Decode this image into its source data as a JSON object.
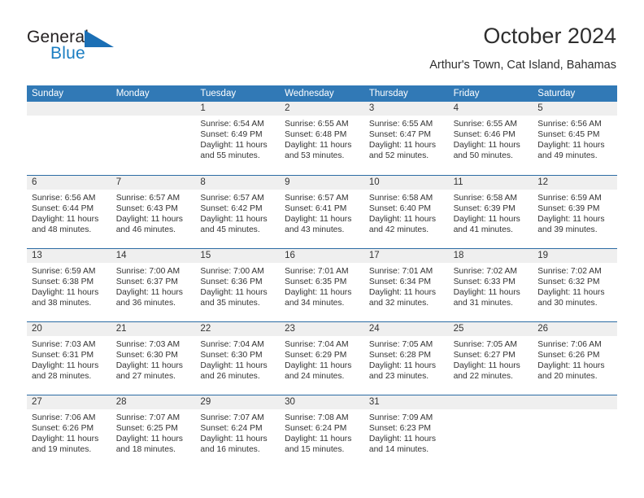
{
  "branding": {
    "logo_text_primary": "General",
    "logo_text_secondary": "Blue",
    "logo_flag_icon": "flag-triangle-icon",
    "accent_color": "#1b7ec2"
  },
  "header": {
    "title": "October 2024",
    "subtitle": "Arthur's Town, Cat Island, Bahamas"
  },
  "colors": {
    "header_row_bg": "#3179b6",
    "week_separator": "#2c6ca4",
    "daynum_band_bg": "#efefef",
    "text": "#333333"
  },
  "weekdays": [
    "Sunday",
    "Monday",
    "Tuesday",
    "Wednesday",
    "Thursday",
    "Friday",
    "Saturday"
  ],
  "weeks": [
    [
      {
        "day": "",
        "sunrise": "",
        "sunset": "",
        "daylight_line1": "",
        "daylight_line2": ""
      },
      {
        "day": "",
        "sunrise": "",
        "sunset": "",
        "daylight_line1": "",
        "daylight_line2": ""
      },
      {
        "day": "1",
        "sunrise": "Sunrise: 6:54 AM",
        "sunset": "Sunset: 6:49 PM",
        "daylight_line1": "Daylight: 11 hours",
        "daylight_line2": "and 55 minutes."
      },
      {
        "day": "2",
        "sunrise": "Sunrise: 6:55 AM",
        "sunset": "Sunset: 6:48 PM",
        "daylight_line1": "Daylight: 11 hours",
        "daylight_line2": "and 53 minutes."
      },
      {
        "day": "3",
        "sunrise": "Sunrise: 6:55 AM",
        "sunset": "Sunset: 6:47 PM",
        "daylight_line1": "Daylight: 11 hours",
        "daylight_line2": "and 52 minutes."
      },
      {
        "day": "4",
        "sunrise": "Sunrise: 6:55 AM",
        "sunset": "Sunset: 6:46 PM",
        "daylight_line1": "Daylight: 11 hours",
        "daylight_line2": "and 50 minutes."
      },
      {
        "day": "5",
        "sunrise": "Sunrise: 6:56 AM",
        "sunset": "Sunset: 6:45 PM",
        "daylight_line1": "Daylight: 11 hours",
        "daylight_line2": "and 49 minutes."
      }
    ],
    [
      {
        "day": "6",
        "sunrise": "Sunrise: 6:56 AM",
        "sunset": "Sunset: 6:44 PM",
        "daylight_line1": "Daylight: 11 hours",
        "daylight_line2": "and 48 minutes."
      },
      {
        "day": "7",
        "sunrise": "Sunrise: 6:57 AM",
        "sunset": "Sunset: 6:43 PM",
        "daylight_line1": "Daylight: 11 hours",
        "daylight_line2": "and 46 minutes."
      },
      {
        "day": "8",
        "sunrise": "Sunrise: 6:57 AM",
        "sunset": "Sunset: 6:42 PM",
        "daylight_line1": "Daylight: 11 hours",
        "daylight_line2": "and 45 minutes."
      },
      {
        "day": "9",
        "sunrise": "Sunrise: 6:57 AM",
        "sunset": "Sunset: 6:41 PM",
        "daylight_line1": "Daylight: 11 hours",
        "daylight_line2": "and 43 minutes."
      },
      {
        "day": "10",
        "sunrise": "Sunrise: 6:58 AM",
        "sunset": "Sunset: 6:40 PM",
        "daylight_line1": "Daylight: 11 hours",
        "daylight_line2": "and 42 minutes."
      },
      {
        "day": "11",
        "sunrise": "Sunrise: 6:58 AM",
        "sunset": "Sunset: 6:39 PM",
        "daylight_line1": "Daylight: 11 hours",
        "daylight_line2": "and 41 minutes."
      },
      {
        "day": "12",
        "sunrise": "Sunrise: 6:59 AM",
        "sunset": "Sunset: 6:39 PM",
        "daylight_line1": "Daylight: 11 hours",
        "daylight_line2": "and 39 minutes."
      }
    ],
    [
      {
        "day": "13",
        "sunrise": "Sunrise: 6:59 AM",
        "sunset": "Sunset: 6:38 PM",
        "daylight_line1": "Daylight: 11 hours",
        "daylight_line2": "and 38 minutes."
      },
      {
        "day": "14",
        "sunrise": "Sunrise: 7:00 AM",
        "sunset": "Sunset: 6:37 PM",
        "daylight_line1": "Daylight: 11 hours",
        "daylight_line2": "and 36 minutes."
      },
      {
        "day": "15",
        "sunrise": "Sunrise: 7:00 AM",
        "sunset": "Sunset: 6:36 PM",
        "daylight_line1": "Daylight: 11 hours",
        "daylight_line2": "and 35 minutes."
      },
      {
        "day": "16",
        "sunrise": "Sunrise: 7:01 AM",
        "sunset": "Sunset: 6:35 PM",
        "daylight_line1": "Daylight: 11 hours",
        "daylight_line2": "and 34 minutes."
      },
      {
        "day": "17",
        "sunrise": "Sunrise: 7:01 AM",
        "sunset": "Sunset: 6:34 PM",
        "daylight_line1": "Daylight: 11 hours",
        "daylight_line2": "and 32 minutes."
      },
      {
        "day": "18",
        "sunrise": "Sunrise: 7:02 AM",
        "sunset": "Sunset: 6:33 PM",
        "daylight_line1": "Daylight: 11 hours",
        "daylight_line2": "and 31 minutes."
      },
      {
        "day": "19",
        "sunrise": "Sunrise: 7:02 AM",
        "sunset": "Sunset: 6:32 PM",
        "daylight_line1": "Daylight: 11 hours",
        "daylight_line2": "and 30 minutes."
      }
    ],
    [
      {
        "day": "20",
        "sunrise": "Sunrise: 7:03 AM",
        "sunset": "Sunset: 6:31 PM",
        "daylight_line1": "Daylight: 11 hours",
        "daylight_line2": "and 28 minutes."
      },
      {
        "day": "21",
        "sunrise": "Sunrise: 7:03 AM",
        "sunset": "Sunset: 6:30 PM",
        "daylight_line1": "Daylight: 11 hours",
        "daylight_line2": "and 27 minutes."
      },
      {
        "day": "22",
        "sunrise": "Sunrise: 7:04 AM",
        "sunset": "Sunset: 6:30 PM",
        "daylight_line1": "Daylight: 11 hours",
        "daylight_line2": "and 26 minutes."
      },
      {
        "day": "23",
        "sunrise": "Sunrise: 7:04 AM",
        "sunset": "Sunset: 6:29 PM",
        "daylight_line1": "Daylight: 11 hours",
        "daylight_line2": "and 24 minutes."
      },
      {
        "day": "24",
        "sunrise": "Sunrise: 7:05 AM",
        "sunset": "Sunset: 6:28 PM",
        "daylight_line1": "Daylight: 11 hours",
        "daylight_line2": "and 23 minutes."
      },
      {
        "day": "25",
        "sunrise": "Sunrise: 7:05 AM",
        "sunset": "Sunset: 6:27 PM",
        "daylight_line1": "Daylight: 11 hours",
        "daylight_line2": "and 22 minutes."
      },
      {
        "day": "26",
        "sunrise": "Sunrise: 7:06 AM",
        "sunset": "Sunset: 6:26 PM",
        "daylight_line1": "Daylight: 11 hours",
        "daylight_line2": "and 20 minutes."
      }
    ],
    [
      {
        "day": "27",
        "sunrise": "Sunrise: 7:06 AM",
        "sunset": "Sunset: 6:26 PM",
        "daylight_line1": "Daylight: 11 hours",
        "daylight_line2": "and 19 minutes."
      },
      {
        "day": "28",
        "sunrise": "Sunrise: 7:07 AM",
        "sunset": "Sunset: 6:25 PM",
        "daylight_line1": "Daylight: 11 hours",
        "daylight_line2": "and 18 minutes."
      },
      {
        "day": "29",
        "sunrise": "Sunrise: 7:07 AM",
        "sunset": "Sunset: 6:24 PM",
        "daylight_line1": "Daylight: 11 hours",
        "daylight_line2": "and 16 minutes."
      },
      {
        "day": "30",
        "sunrise": "Sunrise: 7:08 AM",
        "sunset": "Sunset: 6:24 PM",
        "daylight_line1": "Daylight: 11 hours",
        "daylight_line2": "and 15 minutes."
      },
      {
        "day": "31",
        "sunrise": "Sunrise: 7:09 AM",
        "sunset": "Sunset: 6:23 PM",
        "daylight_line1": "Daylight: 11 hours",
        "daylight_line2": "and 14 minutes."
      },
      {
        "day": "",
        "sunrise": "",
        "sunset": "",
        "daylight_line1": "",
        "daylight_line2": ""
      },
      {
        "day": "",
        "sunrise": "",
        "sunset": "",
        "daylight_line1": "",
        "daylight_line2": ""
      }
    ]
  ]
}
